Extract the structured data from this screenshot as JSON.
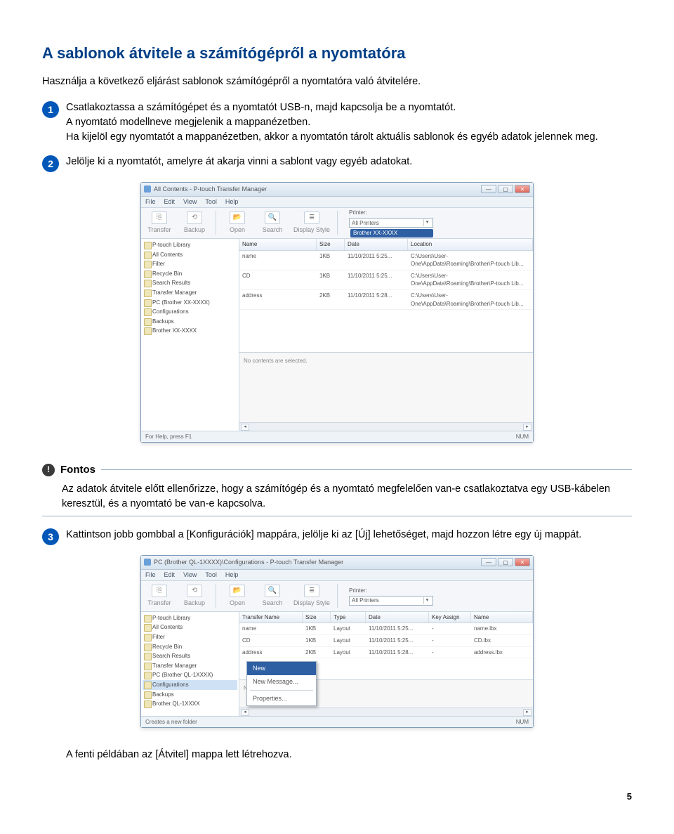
{
  "section_title": "A sablonok átvitele a számítógépről a nyomtatóra",
  "intro": "Használja a következő eljárást sablonok számítógépről a nyomtatóra való átvitelére.",
  "steps": {
    "1": {
      "num": "1",
      "p1": "Csatlakoztassa a számítógépet és a nyomtatót USB-n, majd kapcsolja be a nyomtatót.",
      "p2": "A nyomtató modellneve megjelenik a mappanézetben.",
      "p3": "Ha kijelöl egy nyomtatót a mappanézetben, akkor a nyomtatón tárolt aktuális sablonok és egyéb adatok jelennek meg."
    },
    "2": {
      "num": "2",
      "p1": "Jelölje ki a nyomtatót, amelyre át akarja vinni a sablont vagy egyéb adatokat."
    },
    "3": {
      "num": "3",
      "p1": "Kattintson jobb gombbal a [Konfigurációk] mappára, jelölje ki az [Új] lehetőséget, majd hozzon létre egy új mappát."
    }
  },
  "notice": {
    "badge": "!",
    "label": "Fontos",
    "body": "Az adatok átvitele előtt ellenőrizze, hogy a számítógép és a nyomtató megfelelően van-e csatlakoztatva egy USB-kábelen keresztül, és a nyomtató be van-e kapcsolva."
  },
  "caption": "A fenti példában az [Átvitel] mappa lett létrehozva.",
  "page_number": "5",
  "app1": {
    "title": "All Contents - P-touch Transfer Manager",
    "menu": [
      "File",
      "Edit",
      "View",
      "Tool",
      "Help"
    ],
    "tools": [
      "Transfer",
      "Backup",
      "Open",
      "Search",
      "Display Style"
    ],
    "printer_label": "Printer:",
    "printer_value": "All Printers",
    "side": [
      "P-touch Library",
      "All Contents",
      "Filter",
      "Recycle Bin",
      "Search Results",
      "Transfer Manager",
      "PC (Brother XX-XXXX)",
      "Configurations",
      "Backups",
      "Brother XX-XXXX"
    ],
    "columns": [
      "Name",
      "Size",
      "Date",
      "Location"
    ],
    "rows": [
      {
        "name": "name",
        "size": "1KB",
        "date": "11/10/2011 5:25...",
        "loc": "C:\\Users\\User-One\\AppData\\Roaming\\Brother\\P-touch Lib..."
      },
      {
        "name": "CD",
        "size": "1KB",
        "date": "11/10/2011 5:25...",
        "loc": "C:\\Users\\User-One\\AppData\\Roaming\\Brother\\P-touch Lib..."
      },
      {
        "name": "address",
        "size": "2KB",
        "date": "11/10/2011 5:28...",
        "loc": "C:\\Users\\User-One\\AppData\\Roaming\\Brother\\P-touch Lib..."
      }
    ],
    "highlight_text": "Brother XX-XXXX",
    "detail_msg": "No contents are selected.",
    "status_left": "For Help, press F1",
    "status_right": "NUM"
  },
  "app2": {
    "title": "PC (Brother QL-1XXXX)\\Configurations - P-touch Transfer Manager",
    "menu": [
      "File",
      "Edit",
      "View",
      "Tool",
      "Help"
    ],
    "printer_value": "All Printers",
    "side": [
      "P-touch Library",
      "All Contents",
      "Filter",
      "Recycle Bin",
      "Search Results",
      "Transfer Manager",
      "PC (Brother QL-1XXXX)",
      "Configurations",
      "Backups",
      "Brother QL-1XXXX"
    ],
    "columns": [
      "Transfer Name",
      "Size",
      "Type",
      "Date",
      "Key Assign",
      "Name"
    ],
    "rows": [
      {
        "name": "name",
        "size": "1KB",
        "type": "Layout",
        "date": "11/10/2011 5:25...",
        "key": "-",
        "n": "name.lbx"
      },
      {
        "name": "CD",
        "size": "1KB",
        "type": "Layout",
        "date": "11/10/2011 5:25...",
        "key": "-",
        "n": "CD.lbx"
      },
      {
        "name": "address",
        "size": "2KB",
        "type": "Layout",
        "date": "11/10/2011 5:28...",
        "key": "-",
        "n": "address.lbx"
      }
    ],
    "context_menu": {
      "item1": "New",
      "item2": "New Message...",
      "item3": "Properties..."
    },
    "detail_msg": "No contents are selected.",
    "status_left": "Creates a new folder",
    "status_right": "NUM"
  }
}
